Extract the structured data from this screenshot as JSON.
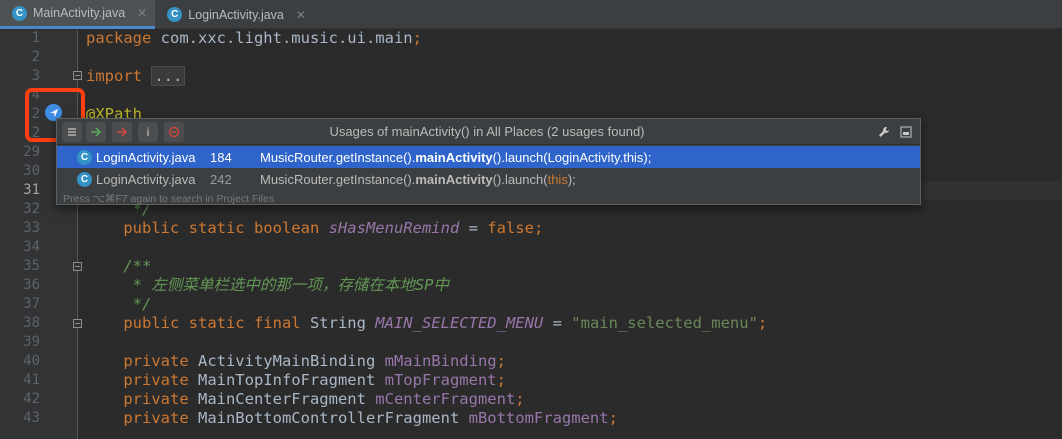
{
  "tabs": [
    {
      "label": "MainActivity.java",
      "icon": "C",
      "active": true
    },
    {
      "label": "LoginActivity.java",
      "icon": "C",
      "active": false
    }
  ],
  "editor": {
    "lines": [
      {
        "num": "1",
        "segments": [
          {
            "t": "package ",
            "c": "kw"
          },
          {
            "t": "com.xxc.light.music.ui.main",
            "c": ""
          },
          {
            "t": ";",
            "c": "kw"
          }
        ]
      },
      {
        "num": "2",
        "segments": []
      },
      {
        "num": "3",
        "segments": [
          {
            "t": "import ",
            "c": "kw"
          },
          {
            "t": "...",
            "c": "fold-box"
          }
        ]
      },
      {
        "num": "4",
        "segments": []
      },
      {
        "num": "2",
        "segments": [
          {
            "t": "@XPath",
            "c": "ann"
          }
        ]
      },
      {
        "num": "2",
        "segments": []
      },
      {
        "num": "29",
        "segments": []
      },
      {
        "num": "30",
        "segments": []
      },
      {
        "num": "31",
        "segments": []
      },
      {
        "num": "32",
        "segments": [
          {
            "t": "     */",
            "c": "doc"
          }
        ]
      },
      {
        "num": "33",
        "segments": [
          {
            "t": "    public static boolean ",
            "c": "kw"
          },
          {
            "t": "sHasMenuRemind",
            "c": "field"
          },
          {
            "t": " = ",
            "c": ""
          },
          {
            "t": "false;",
            "c": "kw"
          }
        ]
      },
      {
        "num": "34",
        "segments": []
      },
      {
        "num": "35",
        "segments": [
          {
            "t": "    /**",
            "c": "doc"
          }
        ]
      },
      {
        "num": "36",
        "segments": [
          {
            "t": "     * 左侧菜单栏选中的那一项，存储在本地SP中",
            "c": "doc"
          }
        ]
      },
      {
        "num": "37",
        "segments": [
          {
            "t": "     */",
            "c": "doc"
          }
        ]
      },
      {
        "num": "38",
        "segments": [
          {
            "t": "    public static final ",
            "c": "kw"
          },
          {
            "t": "String ",
            "c": ""
          },
          {
            "t": "MAIN_SELECTED_MENU",
            "c": "field"
          },
          {
            "t": " = ",
            "c": ""
          },
          {
            "t": "\"main_selected_menu\"",
            "c": "str"
          },
          {
            "t": ";",
            "c": "kw"
          }
        ]
      },
      {
        "num": "39",
        "segments": []
      },
      {
        "num": "40",
        "segments": [
          {
            "t": "    private ",
            "c": "kw"
          },
          {
            "t": "ActivityMainBinding ",
            "c": ""
          },
          {
            "t": "mMainBinding",
            "c": "ifield"
          },
          {
            "t": ";",
            "c": "kw"
          }
        ]
      },
      {
        "num": "41",
        "segments": [
          {
            "t": "    private ",
            "c": "kw"
          },
          {
            "t": "MainTopInfoFragment ",
            "c": ""
          },
          {
            "t": "mTopFragment",
            "c": "ifield"
          },
          {
            "t": ";",
            "c": "kw"
          }
        ]
      },
      {
        "num": "42",
        "segments": [
          {
            "t": "    private ",
            "c": "kw"
          },
          {
            "t": "MainCenterFragment ",
            "c": ""
          },
          {
            "t": "mCenterFragment",
            "c": "ifield"
          },
          {
            "t": ";",
            "c": "kw"
          }
        ]
      },
      {
        "num": "43",
        "segments": [
          {
            "t": "    private ",
            "c": "kw"
          },
          {
            "t": "MainBottomControllerFragment ",
            "c": ""
          },
          {
            "t": "mBottomFragment",
            "c": "ifield"
          },
          {
            "t": ";",
            "c": "kw"
          }
        ]
      }
    ],
    "current_line": "31"
  },
  "popup": {
    "title": "Usages of mainActivity() in All Places (2 usages found)",
    "toolbar": {
      "info_label": "i"
    },
    "rows": [
      {
        "file": "LoginActivity.java",
        "line": "184",
        "pre": "MusicRouter.getInstance().",
        "bold": "mainActivity",
        "post": "().launch(LoginActivity.this);",
        "this": "",
        "end": "",
        "selected": true
      },
      {
        "file": "LoginActivity.java",
        "line": "242",
        "pre": "MusicRouter.getInstance().",
        "bold": "mainActivity",
        "post": "().launch(",
        "this": "this",
        "end": ");",
        "selected": false
      }
    ],
    "footer": "Press ⌥⌘F7 again to search in Project Files"
  },
  "colors": {
    "highlight": "#ff3f11",
    "selection": "#2f65ca",
    "accent": "#3592c4"
  }
}
